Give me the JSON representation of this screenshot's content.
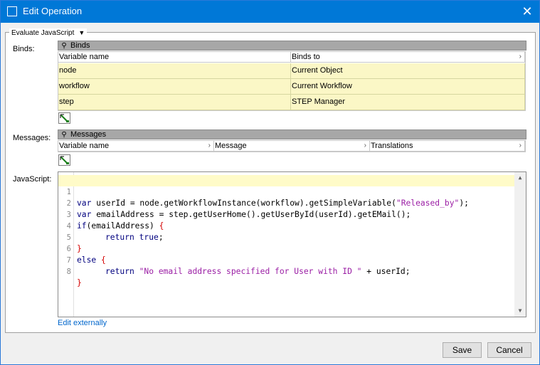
{
  "window": {
    "title": "Edit Operation"
  },
  "group": {
    "title": "Evaluate JavaScript"
  },
  "labels": {
    "binds": "Binds:",
    "messages": "Messages:",
    "javascript": "JavaScript:"
  },
  "binds": {
    "title": "Binds",
    "columns": [
      "Variable name",
      "Binds to"
    ],
    "rows": [
      [
        "node",
        "Current Object"
      ],
      [
        "workflow",
        "Current Workflow"
      ],
      [
        "step",
        "STEP Manager"
      ]
    ]
  },
  "messages": {
    "title": "Messages",
    "columns": [
      "Variable name",
      "Message",
      "Translations"
    ]
  },
  "code_lines": [
    "1",
    "2",
    "3",
    "4",
    "5",
    "6",
    "7",
    "8"
  ],
  "code": {
    "l1_a": "var",
    "l1_b": " userId = node.getWorkflowInstance(workflow).getSimpleVariable(",
    "l1_c": "\"Released_by\"",
    "l1_d": ");",
    "l2_a": "var",
    "l2_b": " emailAddress = step.getUserHome().getUserById(userId).getEMail();",
    "l3_a": "if",
    "l3_b": "(emailAddress) ",
    "l3_c": "{",
    "l4_a": "return",
    "l4_b": " true",
    "l4_c": ";",
    "l5": "}",
    "l6_a": "else",
    "l6_b": " ",
    "l6_c": "{",
    "l7_a": "return",
    "l7_b": " ",
    "l7_c": "\"No email address specified for User with ID \"",
    "l7_d": " + userId;",
    "l8": "}"
  },
  "edit_link": "Edit externally",
  "buttons": {
    "save": "Save",
    "cancel": "Cancel"
  },
  "colors": {
    "titlebar": "#0078d7",
    "bind_row": "#fbf7c6",
    "keyword": "#00007f",
    "string": "#9b1fa5",
    "brace": "#d40000",
    "link": "#0066cc"
  }
}
